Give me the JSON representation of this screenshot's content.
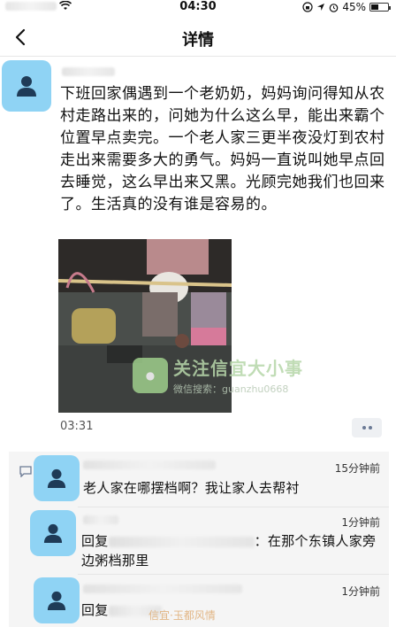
{
  "status_bar": {
    "time": "04:30",
    "battery": "45%",
    "battery_level": 0.45
  },
  "nav": {
    "title": "详情"
  },
  "post": {
    "body": "下班回家偶遇到一个老奶奶，妈妈询问得知从农村走路出来的，问她为什么这么早，能出来霸个位置早点卖完。一个老人家三更半夜没灯到农村走出来需要多大的勇气。妈妈一直说叫她早点回去睡觉，这么早出来又黑。光顾完她我们也回来了。生活真的没有谁是容易的。",
    "time": "03:31",
    "watermark_main": "关注信宜大小事",
    "watermark_sub": "微信搜索：guanzhu0668"
  },
  "comments": [
    {
      "time": "15分钟前",
      "text": "老人家在哪摆档啊？我让家人去帮衬"
    },
    {
      "time": "1分钟前",
      "prefix": "回复",
      "text": "：在那个东镇人家旁边粥档那里"
    },
    {
      "time": "1分钟前",
      "prefix": "回复"
    }
  ],
  "bottom_watermark": "信宜·玉都风情"
}
